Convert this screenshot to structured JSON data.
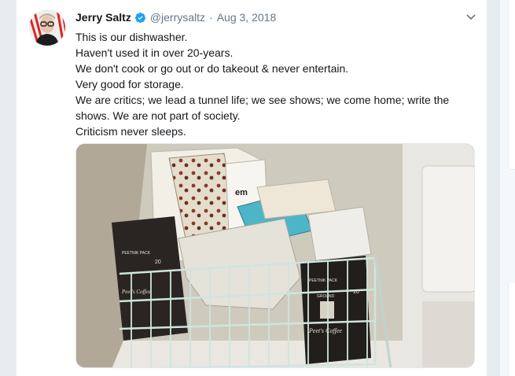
{
  "tweet": {
    "author_name": "Jerry Saltz",
    "author_handle": "@jerrysaltz",
    "separator": "·",
    "date": "Aug 3, 2018",
    "lines": [
      "This is our dishwasher.",
      "Haven't used it in over 20-years.",
      "We don't cook or go out or do takeout & never entertain.",
      "Very good for storage.",
      "We are critics; we lead a tunnel life; we see shows; we come home; write the shows. We are not part of society.",
      "Criticism never sleeps."
    ]
  },
  "icons": {
    "verified": "verified-badge-icon",
    "caret": "chevron-down-icon"
  },
  "colors": {
    "background": "#e6ecf0",
    "card": "#ffffff",
    "text_primary": "#14171a",
    "text_secondary": "#657786",
    "verified_blue": "#1da1f2"
  },
  "media": {
    "bag_label_1": "PEETNIK PACK",
    "bag_size_1": "20",
    "bag_brand_1": "Peet's Coffee",
    "bag_label_2": "PEETNIK PACK",
    "bag_size_2": "20",
    "bag_grind_2": "GROUND",
    "bag_brand_2": "Peet's Coffee",
    "box_text": "em"
  }
}
